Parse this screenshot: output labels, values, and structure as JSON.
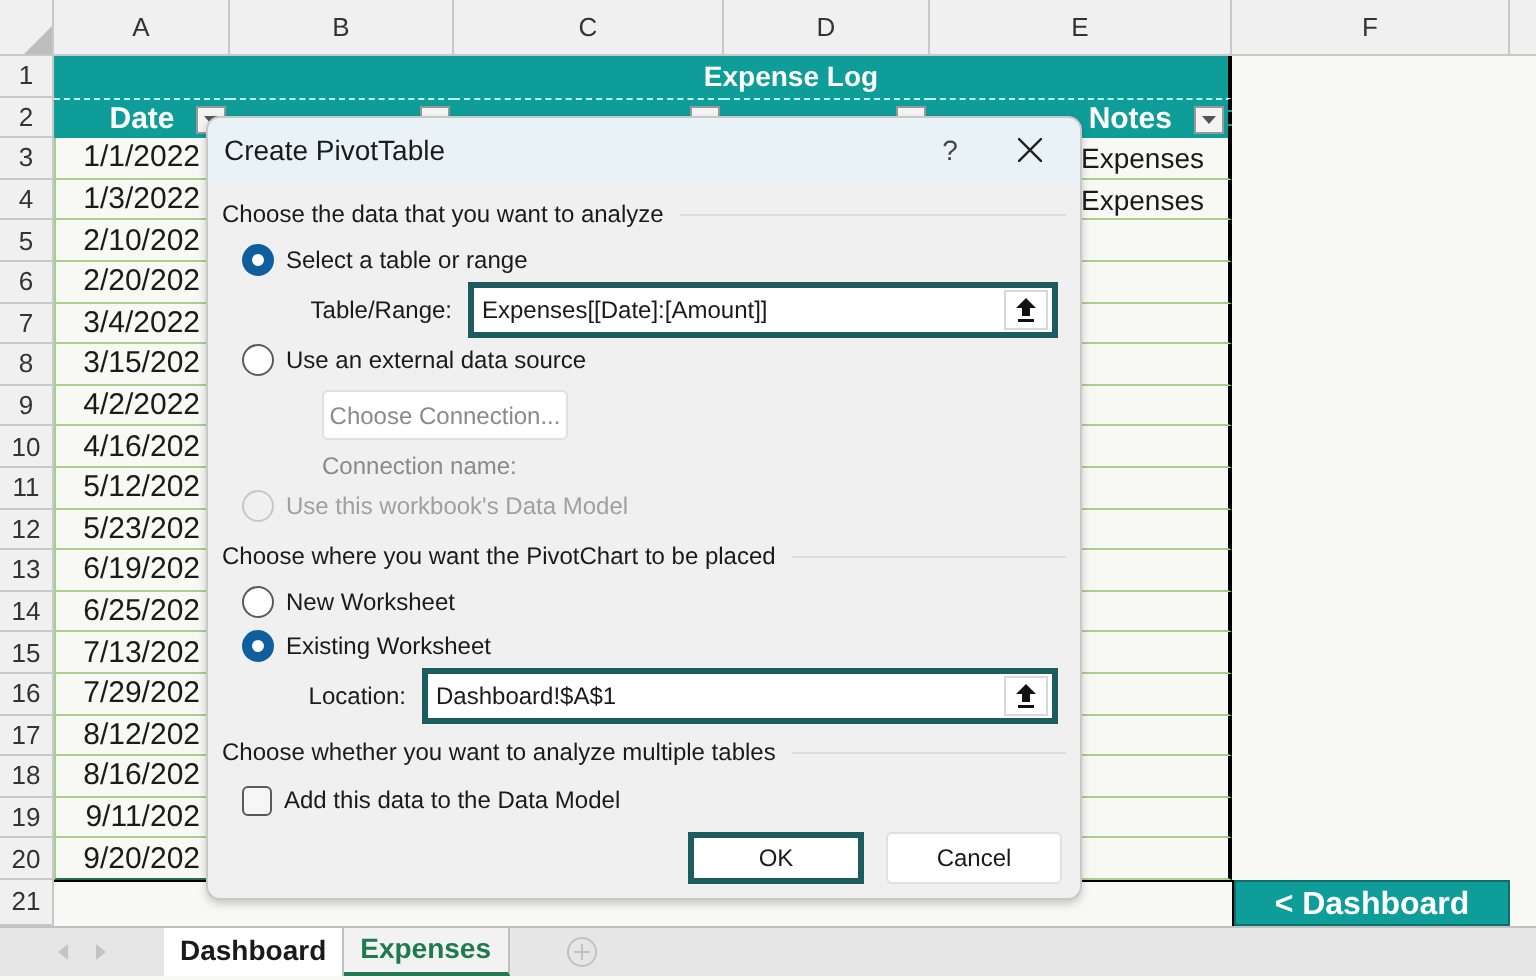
{
  "columns": [
    "A",
    "B",
    "C",
    "D",
    "E",
    "F"
  ],
  "rows": [
    "1",
    "2",
    "3",
    "4",
    "5",
    "6",
    "7",
    "8",
    "9",
    "10",
    "11",
    "12",
    "13",
    "14",
    "15",
    "16",
    "17",
    "18",
    "19",
    "20",
    "21"
  ],
  "title": "Expense Log",
  "headers": [
    "Date",
    "Notes"
  ],
  "dates": [
    "1/1/2022",
    "1/3/2022",
    "2/10/202",
    "2/20/202",
    "3/4/2022",
    "3/15/202",
    "4/2/2022",
    "4/16/202",
    "5/12/202",
    "5/23/202",
    "6/19/202",
    "6/25/202",
    "7/13/202",
    "7/29/202",
    "8/12/202",
    "8/16/202",
    "9/11/202",
    "9/20/202"
  ],
  "notes": [
    "Expenses",
    "Expenses"
  ],
  "dashboard_button": "< Dashboard",
  "sheet_tabs": [
    {
      "label": "Dashboard",
      "selected": false
    },
    {
      "label": "Expenses",
      "selected": true
    }
  ],
  "dialog": {
    "title": "Create PivotTable",
    "help": "?",
    "section_1": "Choose the data that you want to analyze",
    "source_options": [
      {
        "label": "Select a table or range",
        "selected": true,
        "disabled": false
      },
      {
        "label": "Use an external data source",
        "selected": false,
        "disabled": false
      },
      {
        "label": "Use this workbook's Data Model",
        "selected": false,
        "disabled": true
      }
    ],
    "range_label": "Table/Range:",
    "range_value": "Expenses[[Date]:[Amount]]",
    "choose_connection": "Choose Connection...",
    "connection_name": "Connection name:",
    "section_2": "Choose where you want the PivotChart to be placed",
    "place_options": [
      {
        "label": "New Worksheet",
        "selected": false
      },
      {
        "label": "Existing Worksheet",
        "selected": true
      }
    ],
    "location_label": "Location:",
    "location_value": "Dashboard!$A$1",
    "section_3": "Choose whether you want to analyze multiple tables",
    "data_model": {
      "label": "Add this data to the Data Model",
      "checked": false
    },
    "ok": "OK",
    "cancel": "Cancel"
  }
}
